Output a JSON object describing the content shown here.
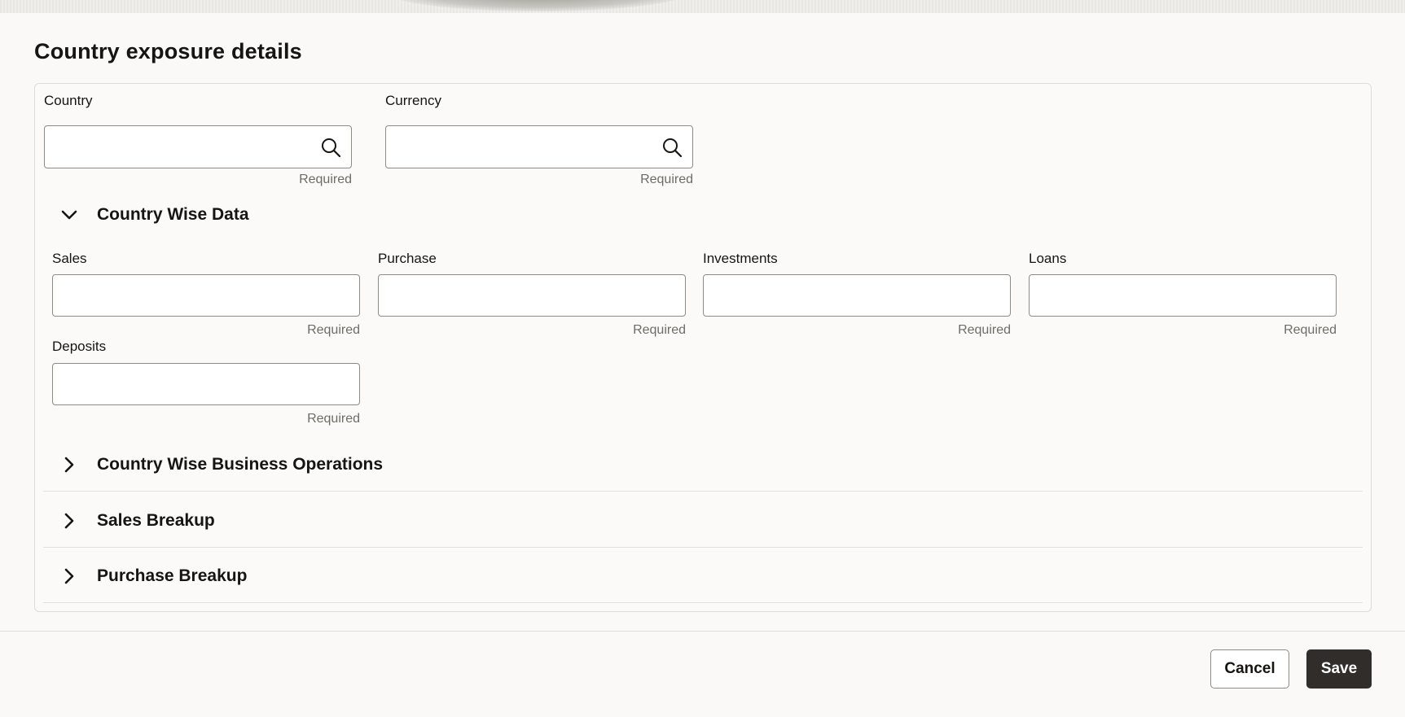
{
  "page": {
    "title": "Country exposure details"
  },
  "header_fields": [
    {
      "label": "Country",
      "value": "",
      "hint": "Required",
      "icon": "search-icon"
    },
    {
      "label": "Currency",
      "value": "",
      "hint": "Required",
      "icon": "search-icon"
    }
  ],
  "sections": [
    {
      "title": "Country Wise Data",
      "expanded": true,
      "fields": [
        {
          "label": "Sales",
          "value": "",
          "hint": "Required"
        },
        {
          "label": "Purchase",
          "value": "",
          "hint": "Required"
        },
        {
          "label": "Investments",
          "value": "",
          "hint": "Required"
        },
        {
          "label": "Loans",
          "value": "",
          "hint": "Required"
        },
        {
          "label": "Deposits",
          "value": "",
          "hint": "Required"
        }
      ]
    },
    {
      "title": "Country Wise Business Operations",
      "expanded": false
    },
    {
      "title": "Sales Breakup",
      "expanded": false
    },
    {
      "title": "Purchase Breakup",
      "expanded": false
    }
  ],
  "footer": {
    "cancel_label": "Cancel",
    "save_label": "Save"
  },
  "colors": {
    "background": "#faf9f7",
    "primary_button": "#312d2a",
    "border": "#8e8b86",
    "hint_text": "#6f6c67"
  }
}
